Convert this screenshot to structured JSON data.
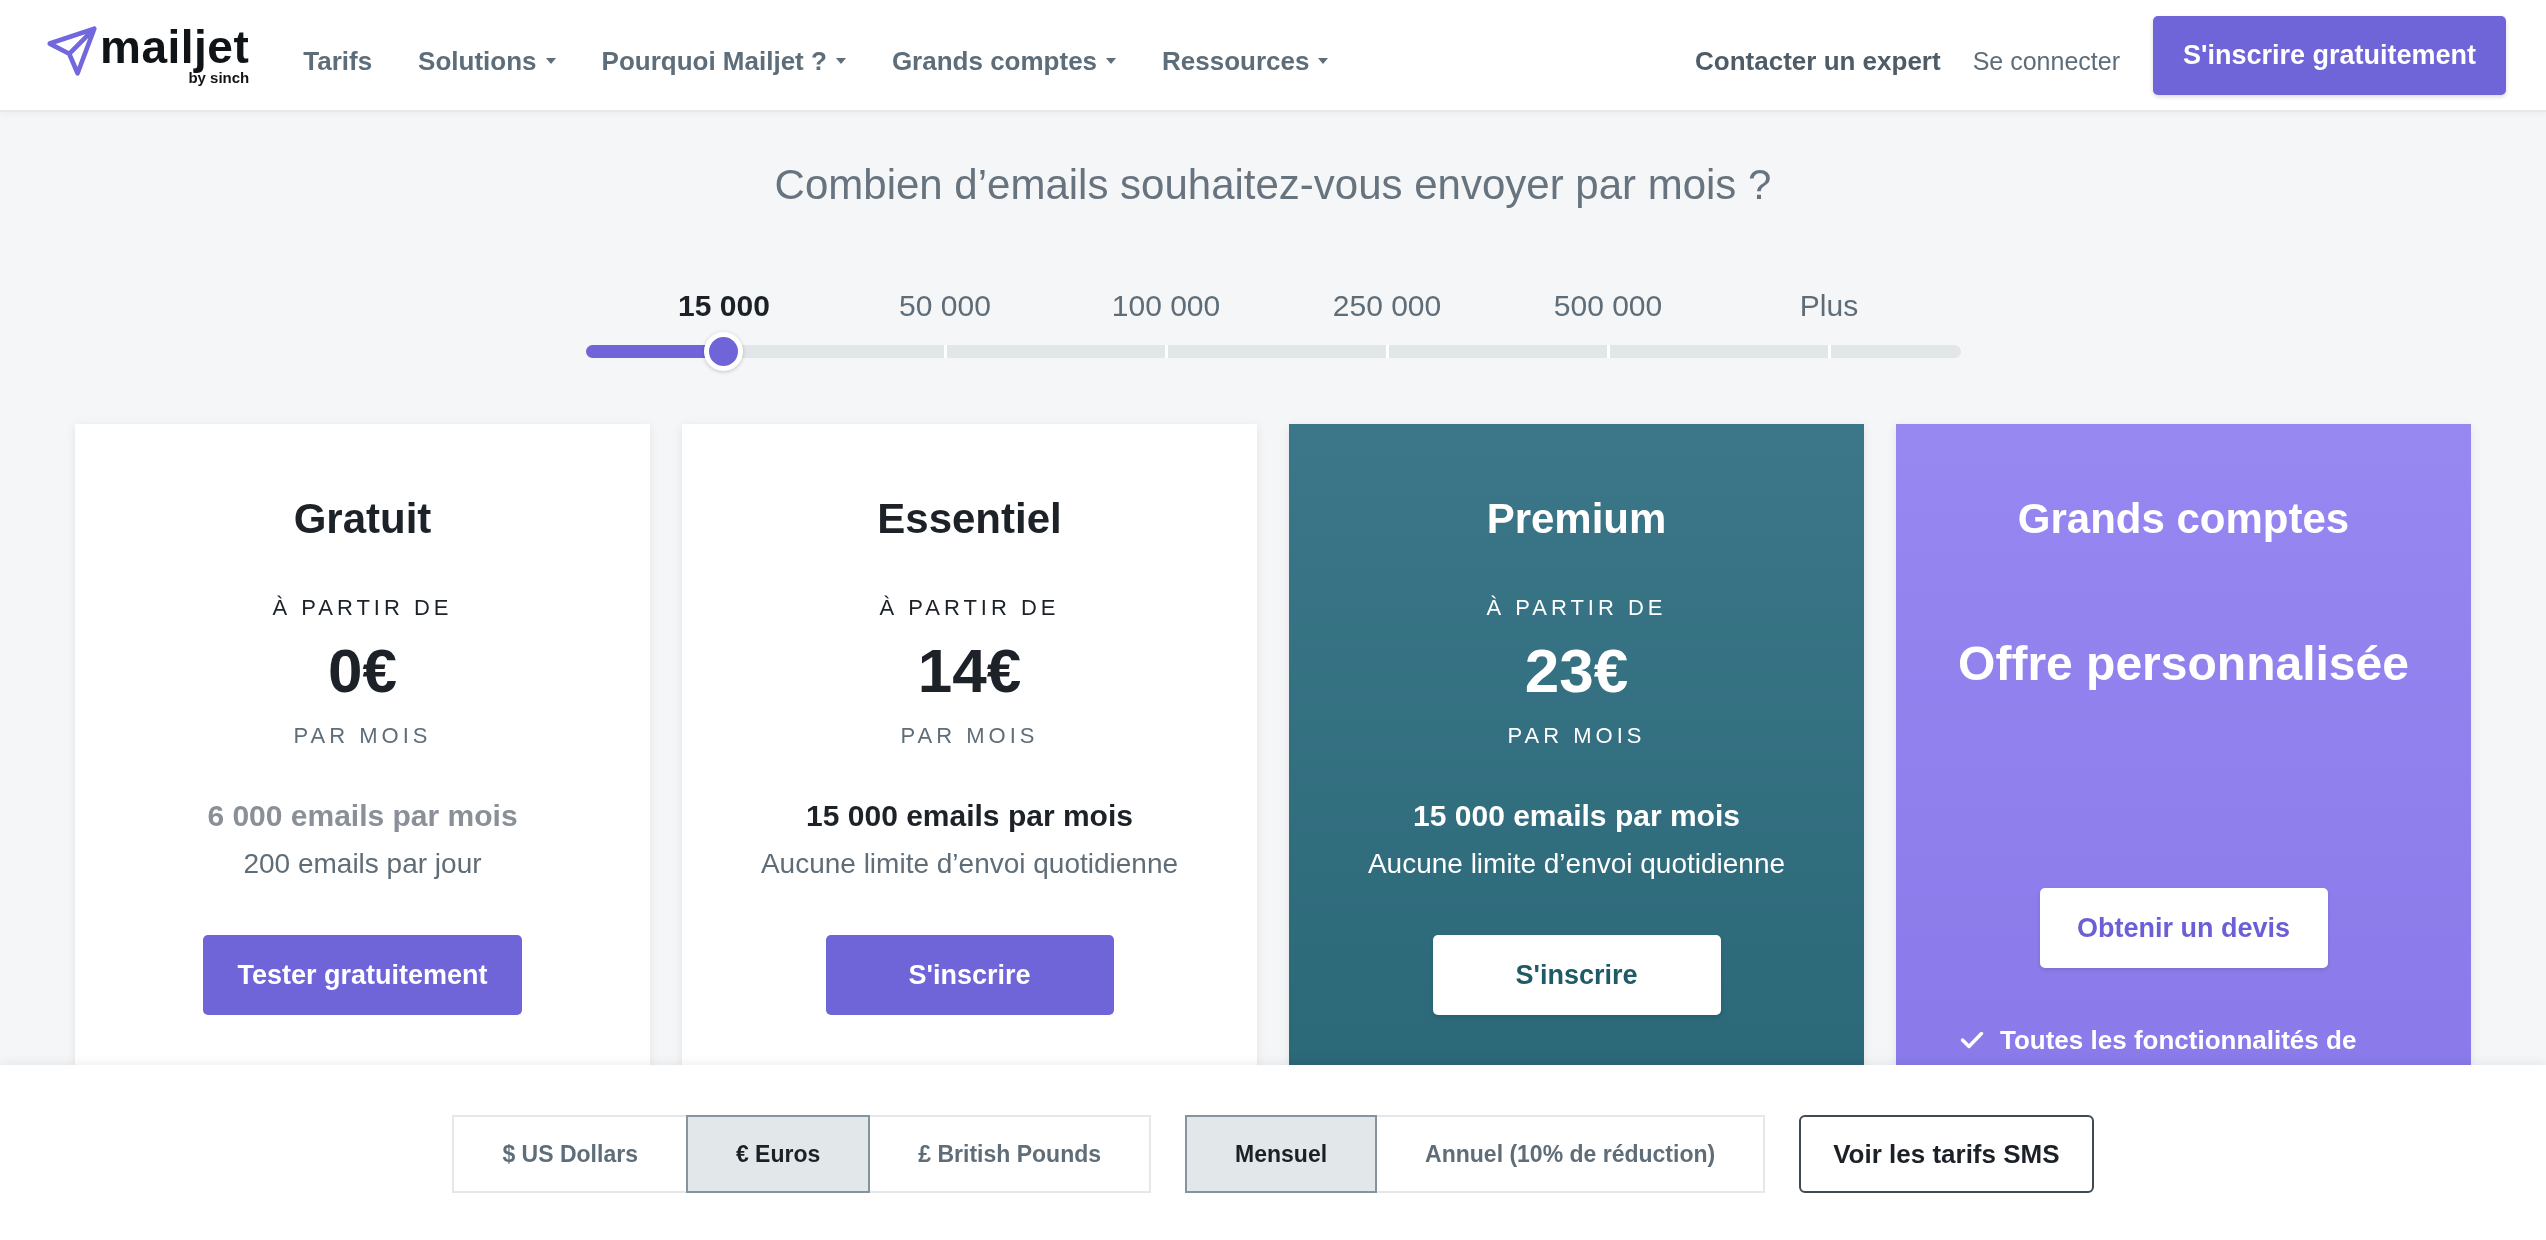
{
  "header": {
    "logo": {
      "wordmark": "mailjet",
      "byline": "by sinch"
    },
    "nav": [
      {
        "label": "Tarifs",
        "has_menu": false
      },
      {
        "label": "Solutions",
        "has_menu": true
      },
      {
        "label": "Pourquoi Mailjet ?",
        "has_menu": true
      },
      {
        "label": "Grands comptes",
        "has_menu": true
      },
      {
        "label": "Ressources",
        "has_menu": true
      }
    ],
    "contact_link": "Contacter un expert",
    "login_link": "Se connecter",
    "signup_button": "S'inscrire gratuitement"
  },
  "volume": {
    "question": "Combien d’emails souhaitez-vous envoyer par mois ?",
    "stops": [
      {
        "label": "15 000",
        "selected": true
      },
      {
        "label": "50 000",
        "selected": false
      },
      {
        "label": "100 000",
        "selected": false
      },
      {
        "label": "250 000",
        "selected": false
      },
      {
        "label": "500 000",
        "selected": false
      },
      {
        "label": "Plus",
        "selected": false
      }
    ],
    "level": 0.1
  },
  "plans": [
    {
      "kind": "standard",
      "name": "Gratuit",
      "price_caption": "À PARTIR DE",
      "price": "0€",
      "period": "PAR MOIS",
      "quota": {
        "text": "6 000 emails par mois",
        "muted": true
      },
      "limit": "200 emails par jour",
      "button": "Tester gratuitement"
    },
    {
      "kind": "standard",
      "name": "Essentiel",
      "price_caption": "À PARTIR DE",
      "price": "14€",
      "period": "PAR MOIS",
      "quota": {
        "text": "15 000 emails par mois",
        "muted": false
      },
      "limit": "Aucune limite d’envoi quotidienne",
      "button": "S'inscrire"
    },
    {
      "kind": "featured",
      "name": "Premium",
      "price_caption": "À PARTIR DE",
      "price": "23€",
      "period": "PAR MOIS",
      "quota": {
        "text": "15 000 emails par mois",
        "muted": false
      },
      "limit": "Aucune limite d’envoi quotidienne",
      "button": "S'inscrire"
    },
    {
      "kind": "enterprise",
      "name": "Grands comptes",
      "offer": "Offre personnalisée",
      "button": "Obtenir un devis",
      "features": [
        "Toutes les fonctionnalités de"
      ]
    }
  ],
  "bottom_bar": {
    "currencies": [
      {
        "label": "$ US Dollars",
        "selected": false
      },
      {
        "label": "€ Euros",
        "selected": true
      },
      {
        "label": "£ British Pounds",
        "selected": false
      }
    ],
    "billing": [
      {
        "label": "Mensuel",
        "selected": true
      },
      {
        "label": "Annuel (10% de réduction)",
        "selected": false
      }
    ],
    "sms_button": "Voir les tarifs SMS"
  }
}
